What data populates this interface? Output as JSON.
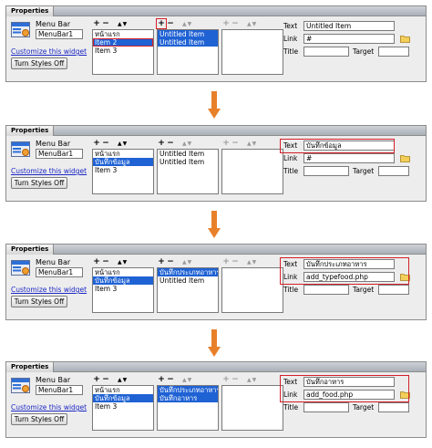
{
  "header": {
    "tab_label": "Properties"
  },
  "widget": {
    "type_label": "Menu Bar",
    "name_value": "MenuBar1",
    "customize_link": "Customize this widget",
    "styles_button": "Turn Styles Off"
  },
  "controls": {
    "add": "+",
    "remove": "−",
    "arrows": "▲▼"
  },
  "labels": {
    "text": "Text",
    "link": "Link",
    "title": "Title",
    "target": "Target"
  },
  "accent": {
    "selection": "#1f62d4",
    "highlight": "#d4202a",
    "arrow": "#e8802a",
    "link": "#1d29c5"
  },
  "panels": [
    {
      "list1": [
        "หน้าแรก",
        "Item 2",
        "Item 3"
      ],
      "list2": [
        "Untitled Item",
        "Untitled Item"
      ],
      "text_value": "Untitled Item",
      "link_value": "#"
    },
    {
      "list1": [
        "หน้าแรก",
        "บันทึกข้อมูล",
        "Item 3"
      ],
      "list2": [
        "Untitled Item",
        "Untitled Item"
      ],
      "text_value": "บันทึกข้อมูล",
      "link_value": "#"
    },
    {
      "list1": [
        "หน้าแรก",
        "บันทึกข้อมูล",
        "Item 3"
      ],
      "list2": [
        "บันทึกประเภทอาหาร",
        "Untitled Item"
      ],
      "text_value": "บันทึกประเภทอาหาร",
      "link_value": "add_typefood.php"
    },
    {
      "list1": [
        "หน้าแรก",
        "บันทึกข้อมูล",
        "Item 3"
      ],
      "list2": [
        "บันทึกประเภทอาหาร",
        "บันทึกอาหาร"
      ],
      "text_value": "บันทึกอาหาร",
      "link_value": "add_food.php"
    }
  ]
}
